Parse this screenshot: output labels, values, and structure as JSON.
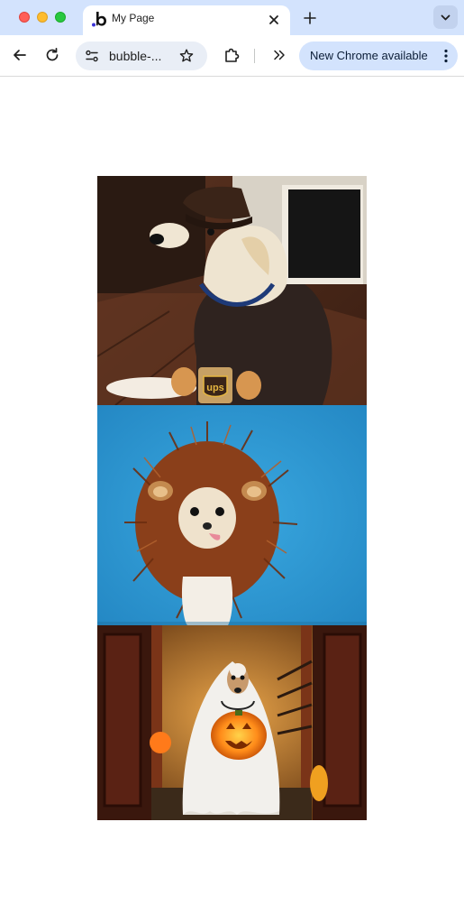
{
  "window": {
    "tab": {
      "title": "My Page",
      "favicon": "bubble-b-icon"
    },
    "tab_search_icon": "chevron-down-icon"
  },
  "toolbar": {
    "back_icon": "arrow-left-icon",
    "reload_icon": "reload-icon",
    "omnibox": {
      "url": "bubble-...",
      "site_info_icon": "tune-icon",
      "bookmark_icon": "star-icon"
    },
    "extensions_icon": "puzzle-icon",
    "overflow_icon": "chevrons-right-icon",
    "update_label": "New Chrome available",
    "menu_icon": "kebab-menu-icon"
  },
  "page": {
    "images": [
      {
        "description": "dog in UPS uniform",
        "badge_text": "ups"
      },
      {
        "description": "chihuahua in lion mane"
      },
      {
        "description": "dog in ghost costume with pumpkin"
      }
    ]
  },
  "colors": {
    "tabstrip_bg": "#d3e3fd",
    "omnibox_bg": "#e9eef6",
    "update_pill_bg": "#d3e3fd",
    "sky_blue": "#2f9bd3"
  }
}
